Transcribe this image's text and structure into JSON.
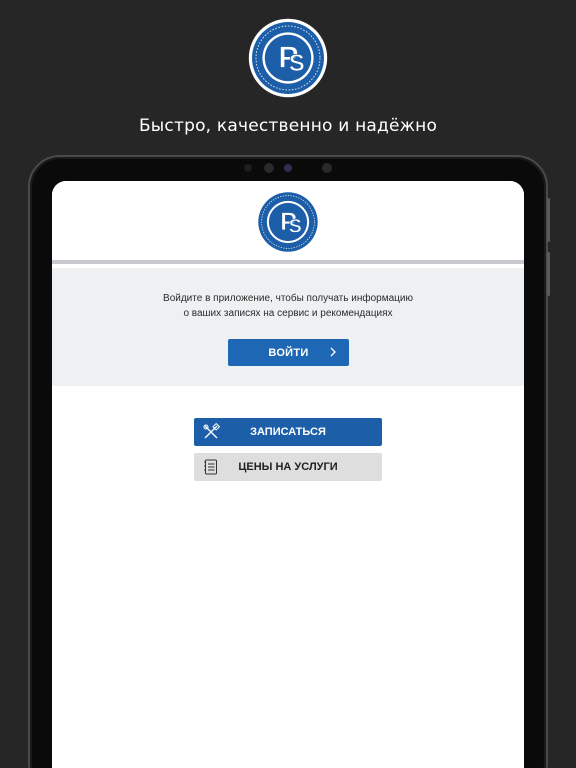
{
  "promo": {
    "tagline": "Быстро, качественно и надёжно"
  },
  "app": {
    "login_prompt_line1": "Войдите в приложение, чтобы получать информацию",
    "login_prompt_line2": "о ваших записях на сервис и рекомендациях",
    "login_button_label": "ВОЙТИ",
    "book_button_label": "ЗАПИСАТЬСЯ",
    "prices_button_label": "ЦЕНЫ НА УСЛУГИ"
  },
  "icons": {
    "logo": "ps-emblem-logo",
    "login_chevron": "chevron-right-icon",
    "book": "tools-icon",
    "prices": "price-list-icon"
  },
  "colors": {
    "background": "#262626",
    "brand_blue": "#1d5ea8",
    "login_blue": "#1d67b4",
    "panel_gray": "#eef0f2",
    "secondary_button": "#dedede"
  }
}
